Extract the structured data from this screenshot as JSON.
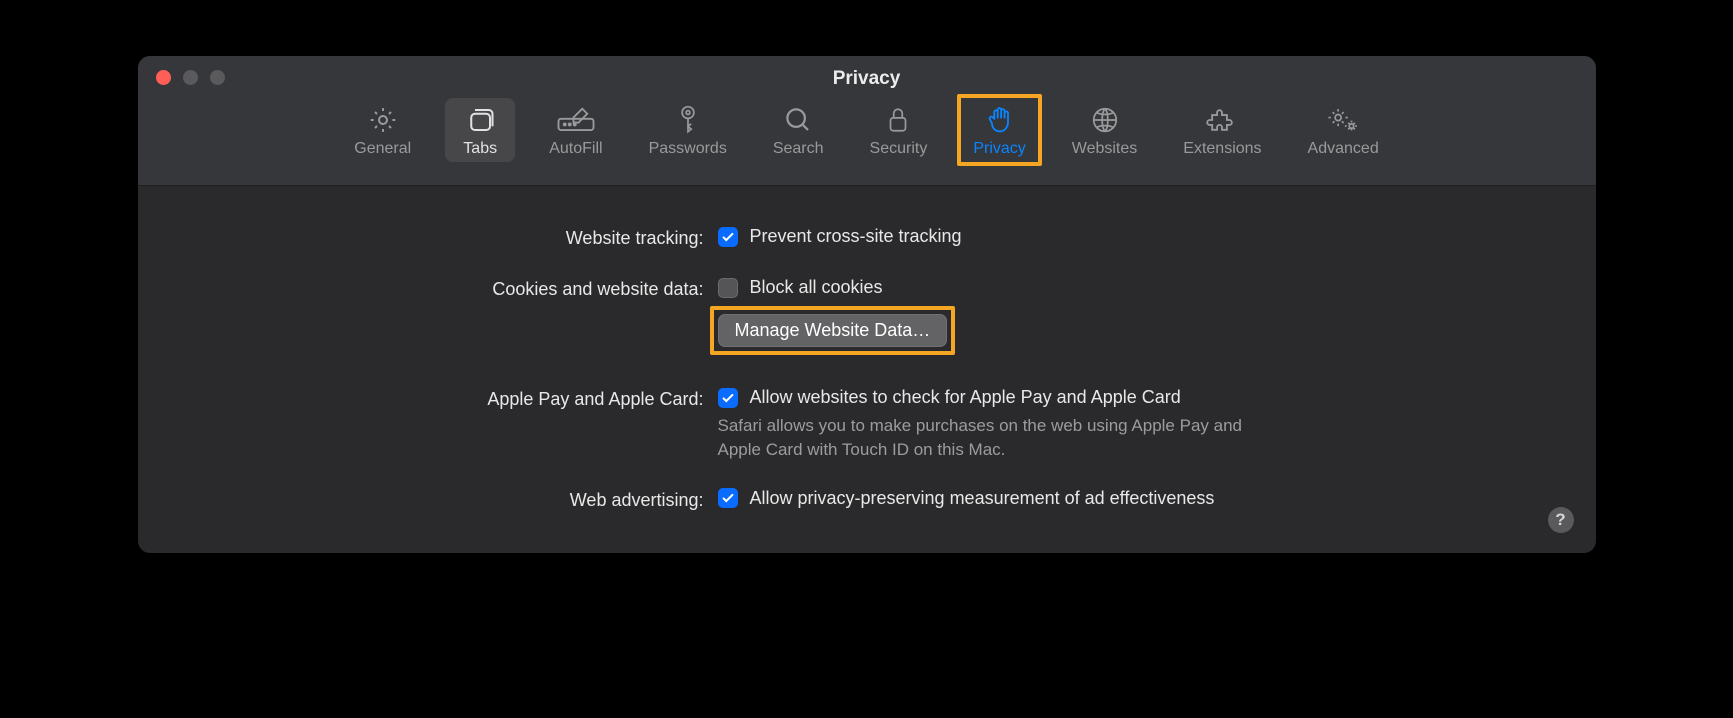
{
  "window": {
    "title": "Privacy"
  },
  "toolbar": {
    "items": [
      {
        "id": "general",
        "label": "General"
      },
      {
        "id": "tabs",
        "label": "Tabs"
      },
      {
        "id": "autofill",
        "label": "AutoFill"
      },
      {
        "id": "passwords",
        "label": "Passwords"
      },
      {
        "id": "search",
        "label": "Search"
      },
      {
        "id": "security",
        "label": "Security"
      },
      {
        "id": "privacy",
        "label": "Privacy"
      },
      {
        "id": "websites",
        "label": "Websites"
      },
      {
        "id": "extensions",
        "label": "Extensions"
      },
      {
        "id": "advanced",
        "label": "Advanced"
      }
    ]
  },
  "sections": {
    "tracking": {
      "label": "Website tracking:",
      "checkbox_label": "Prevent cross-site tracking",
      "checked": true
    },
    "cookies": {
      "label": "Cookies and website data:",
      "checkbox_label": "Block all cookies",
      "checked": false,
      "manage_button": "Manage Website Data…"
    },
    "applepay": {
      "label": "Apple Pay and Apple Card:",
      "checkbox_label": "Allow websites to check for Apple Pay and Apple Card",
      "checked": true,
      "description": "Safari allows you to make purchases on the web using Apple Pay and Apple Card with Touch ID on this Mac."
    },
    "ads": {
      "label": "Web advertising:",
      "checkbox_label": "Allow privacy-preserving measurement of ad effectiveness",
      "checked": true
    }
  },
  "help_button": "?"
}
